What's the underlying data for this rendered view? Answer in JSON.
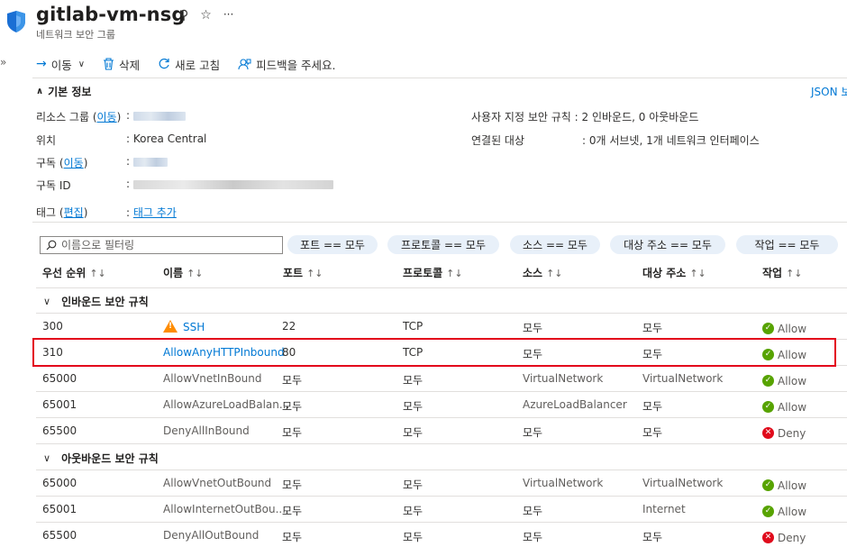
{
  "header": {
    "title": "gitlab-vm-nsg",
    "subtitle": "네트워크 보안 그룹",
    "collapse_glyph": "»"
  },
  "toolbar": {
    "move_label": "이동",
    "delete_label": "삭제",
    "refresh_label": "새로 고침",
    "feedback_label": "피드백을 주세요."
  },
  "essentials": {
    "title": "기본 정보",
    "json_view": "JSON 보",
    "resource_group_label": "리소스 그룹",
    "move_link": "이동",
    "location_label": "위치",
    "location_value": "Korea Central",
    "subscription_label": "구독",
    "subscription_id_label": "구독 ID",
    "tags_label": "태그",
    "edit_link": "편집",
    "tags_value": "태그 추가",
    "custom_rules_label": "사용자 지정 보안 규칙",
    "custom_rules_value": "2 인바운드, 0 아웃바운드",
    "associated_label": "연결된 대상",
    "associated_value": "0개 서브넷, 1개 네트워크 인터페이스"
  },
  "filter": {
    "placeholder": "이름으로 필터링",
    "pills": [
      "포트 == 모두",
      "프로토콜 == 모두",
      "소스 == 모두",
      "대상 주소 == 모두",
      "작업 == 모두"
    ]
  },
  "table": {
    "columns": [
      "우선 순위",
      "이름",
      "포트",
      "프로토콜",
      "소스",
      "대상 주소",
      "작업"
    ],
    "sort_glyph": "↑↓",
    "inbound_group": "인바운드 보안 규칙",
    "outbound_group": "아웃바운드 보안 규칙",
    "inbound": [
      {
        "priority": "300",
        "name": "SSH",
        "port": "22",
        "protocol": "TCP",
        "source": "모두",
        "destination": "모두",
        "action": "Allow",
        "warning": true,
        "link": true
      },
      {
        "priority": "310",
        "name": "AllowAnyHTTPInbound",
        "port": "80",
        "protocol": "TCP",
        "source": "모두",
        "destination": "모두",
        "action": "Allow",
        "warning": false,
        "link": true,
        "highlighted": true
      },
      {
        "priority": "65000",
        "name": "AllowVnetInBound",
        "port": "모두",
        "protocol": "모두",
        "source": "VirtualNetwork",
        "destination": "VirtualNetwork",
        "action": "Allow"
      },
      {
        "priority": "65001",
        "name": "AllowAzureLoadBalan...",
        "port": "모두",
        "protocol": "모두",
        "source": "AzureLoadBalancer",
        "destination": "모두",
        "action": "Allow"
      },
      {
        "priority": "65500",
        "name": "DenyAllInBound",
        "port": "모두",
        "protocol": "모두",
        "source": "모두",
        "destination": "모두",
        "action": "Deny"
      }
    ],
    "outbound": [
      {
        "priority": "65000",
        "name": "AllowVnetOutBound",
        "port": "모두",
        "protocol": "모두",
        "source": "VirtualNetwork",
        "destination": "VirtualNetwork",
        "action": "Allow"
      },
      {
        "priority": "65001",
        "name": "AllowInternetOutBou...",
        "port": "모두",
        "protocol": "모두",
        "source": "모두",
        "destination": "Internet",
        "action": "Allow"
      },
      {
        "priority": "65500",
        "name": "DenyAllOutBound",
        "port": "모두",
        "protocol": "모두",
        "source": "모두",
        "destination": "모두",
        "action": "Deny"
      }
    ]
  },
  "colors": {
    "accent": "#0078d4",
    "allow": "#57a300",
    "deny": "#e00b1c",
    "warning": "#ff8c00",
    "highlight_border": "#e3001b",
    "pill_bg": "#e8f0f9"
  },
  "icons": [
    "nsg-shield-icon",
    "pin-icon",
    "star-icon",
    "more-icon",
    "arrow-right-icon",
    "trash-icon",
    "refresh-icon",
    "feedback-icon",
    "chevron-up-icon",
    "search-icon",
    "sort-icon",
    "chevron-down-icon",
    "warning-icon",
    "allow-check-icon",
    "deny-x-icon"
  ]
}
